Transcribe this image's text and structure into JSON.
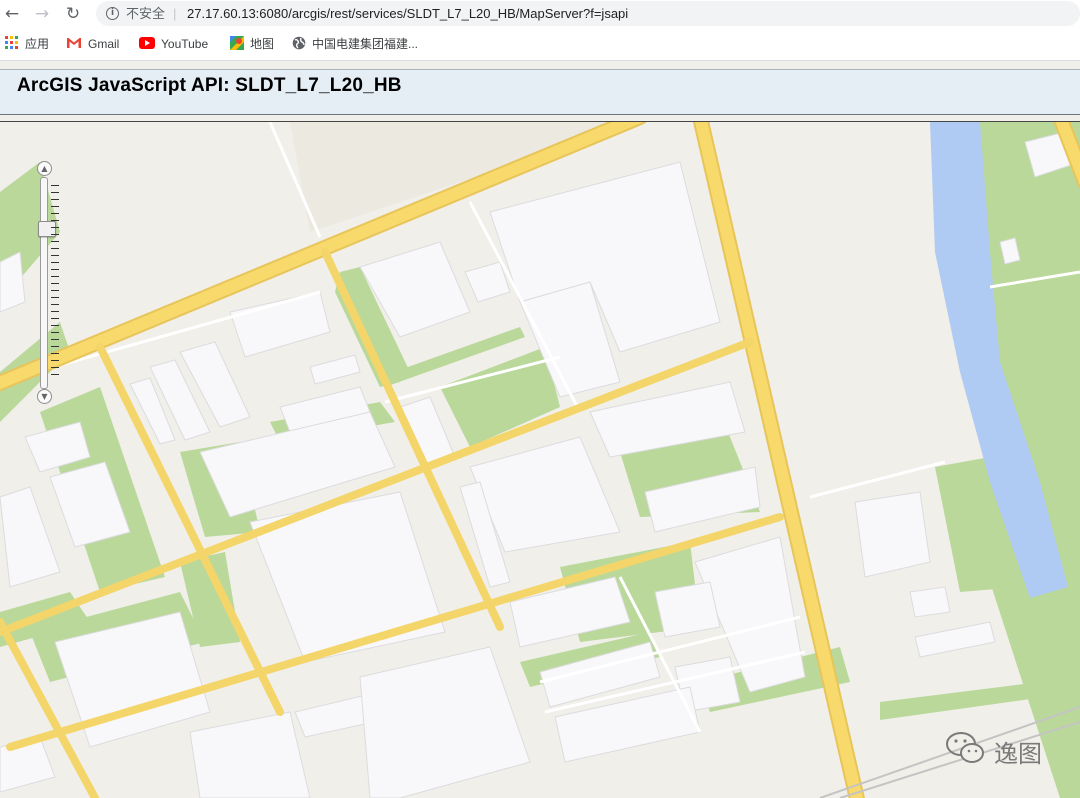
{
  "browser": {
    "back_icon": "arrow-left-icon",
    "forward_icon": "arrow-right-icon",
    "reload_icon": "reload-icon",
    "security_label": "不安全",
    "separator": "|",
    "url": "27.17.60.13:6080/arcgis/rest/services/SLDT_L7_L20_HB/MapServer?f=jsapi"
  },
  "bookmarks": [
    {
      "label": "应用",
      "icon": "apps-grid-icon"
    },
    {
      "label": "Gmail",
      "icon": "gmail-icon"
    },
    {
      "label": "YouTube",
      "icon": "youtube-icon"
    },
    {
      "label": "地图",
      "icon": "maps-icon"
    },
    {
      "label": "中国电建集团福建...",
      "icon": "globe-icon"
    }
  ],
  "page": {
    "title": "ArcGIS JavaScript API: SLDT_L7_L20_HB"
  },
  "zoom": {
    "in_symbol": "▲",
    "out_symbol": "▼",
    "level_fraction": 0.22
  },
  "watermark": {
    "text": "逸图"
  },
  "colors": {
    "road_major": "#f7da6b",
    "road_minor": "#fae8a0",
    "road_casing": "#e8c55a",
    "building": "#f8f8fa",
    "green": "#b9d89a",
    "water": "#afcaf3",
    "background": "#f1efe9",
    "header_bg": "#e5edf5"
  }
}
